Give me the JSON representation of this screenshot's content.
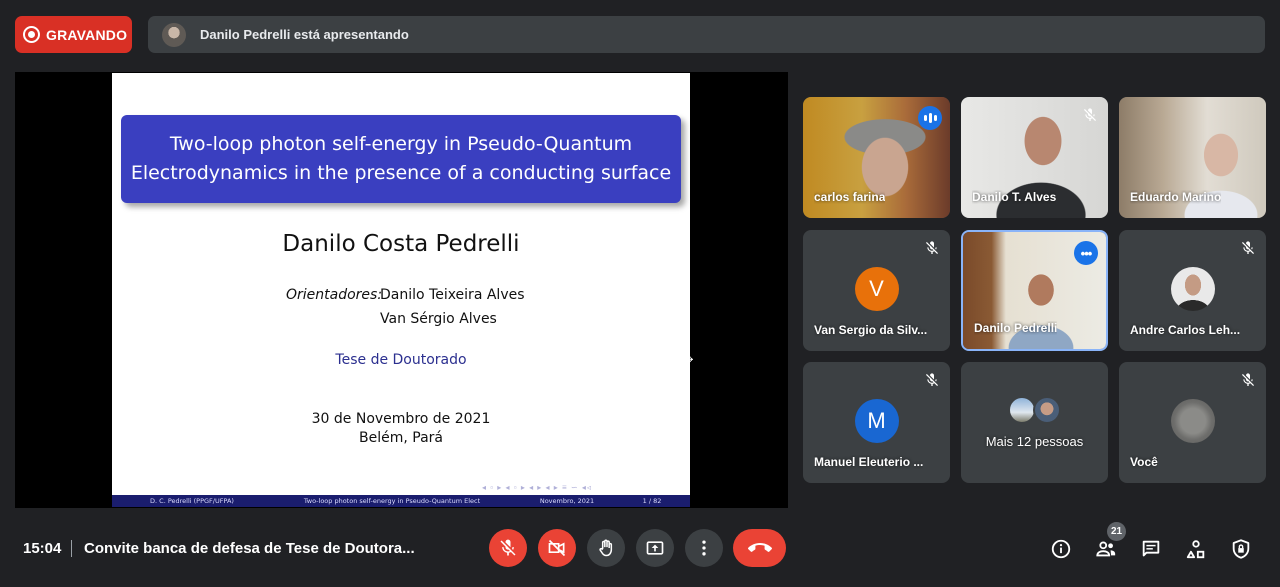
{
  "recording": {
    "label": "GRAVANDO"
  },
  "presenting": {
    "text": "Danilo Pedrelli está apresentando"
  },
  "slide": {
    "title_line1": "Two-loop photon self-energy in Pseudo-Quantum",
    "title_line2": "Electrodynamics in the presence of a conducting surface",
    "author": "Danilo Costa Pedrelli",
    "advisors_label": "Orientadores:",
    "advisor1": "Danilo Teixeira Alves",
    "advisor2": "Van Sérgio Alves",
    "thesis": "Tese de Doutorado",
    "date": "30 de Novembro de 2021",
    "place": "Belém, Pará",
    "footer_author": "D. C. Pedrelli  (PPGF/UFPA)",
    "footer_title": "Two-loop photon self-energy in Pseudo-Quantum Elect",
    "footer_date": "Novembro, 2021",
    "footer_page": "1 / 82"
  },
  "participants": [
    {
      "name": "carlos farina",
      "state": "speaking"
    },
    {
      "name": "Danilo T. Alves",
      "state": "muted"
    },
    {
      "name": "Eduardo Marino",
      "state": "none"
    },
    {
      "name": "Van Sergio da Silv...",
      "initial": "V",
      "color": "#e8710a",
      "state": "muted"
    },
    {
      "name": "Danilo Pedrelli",
      "state": "presenting"
    },
    {
      "name": "Andre Carlos Leh...",
      "state": "muted"
    },
    {
      "name": "Manuel Eleuterio ...",
      "initial": "M",
      "color": "#1967d2",
      "state": "muted"
    },
    {
      "name": "Mais 12 pessoas",
      "state": "none"
    },
    {
      "name": "Você",
      "state": "muted"
    }
  ],
  "bottom": {
    "time": "15:04",
    "meeting_title": "Convite banca de defesa de Tese de Doutora...",
    "people_count": "21"
  },
  "icons": {
    "mic": "mic-off-icon",
    "camera": "camera-off-icon",
    "hand": "raise-hand-icon",
    "present": "present-screen-icon",
    "more": "more-vert-icon",
    "hangup": "call-end-icon",
    "info": "info-icon",
    "people": "people-icon",
    "chat": "chat-icon",
    "activities": "activities-icon",
    "host": "host-controls-icon"
  },
  "colors": {
    "record_red": "#d93025",
    "accent_blue": "#1a73e8",
    "slide_blue": "#3a3fc0"
  }
}
